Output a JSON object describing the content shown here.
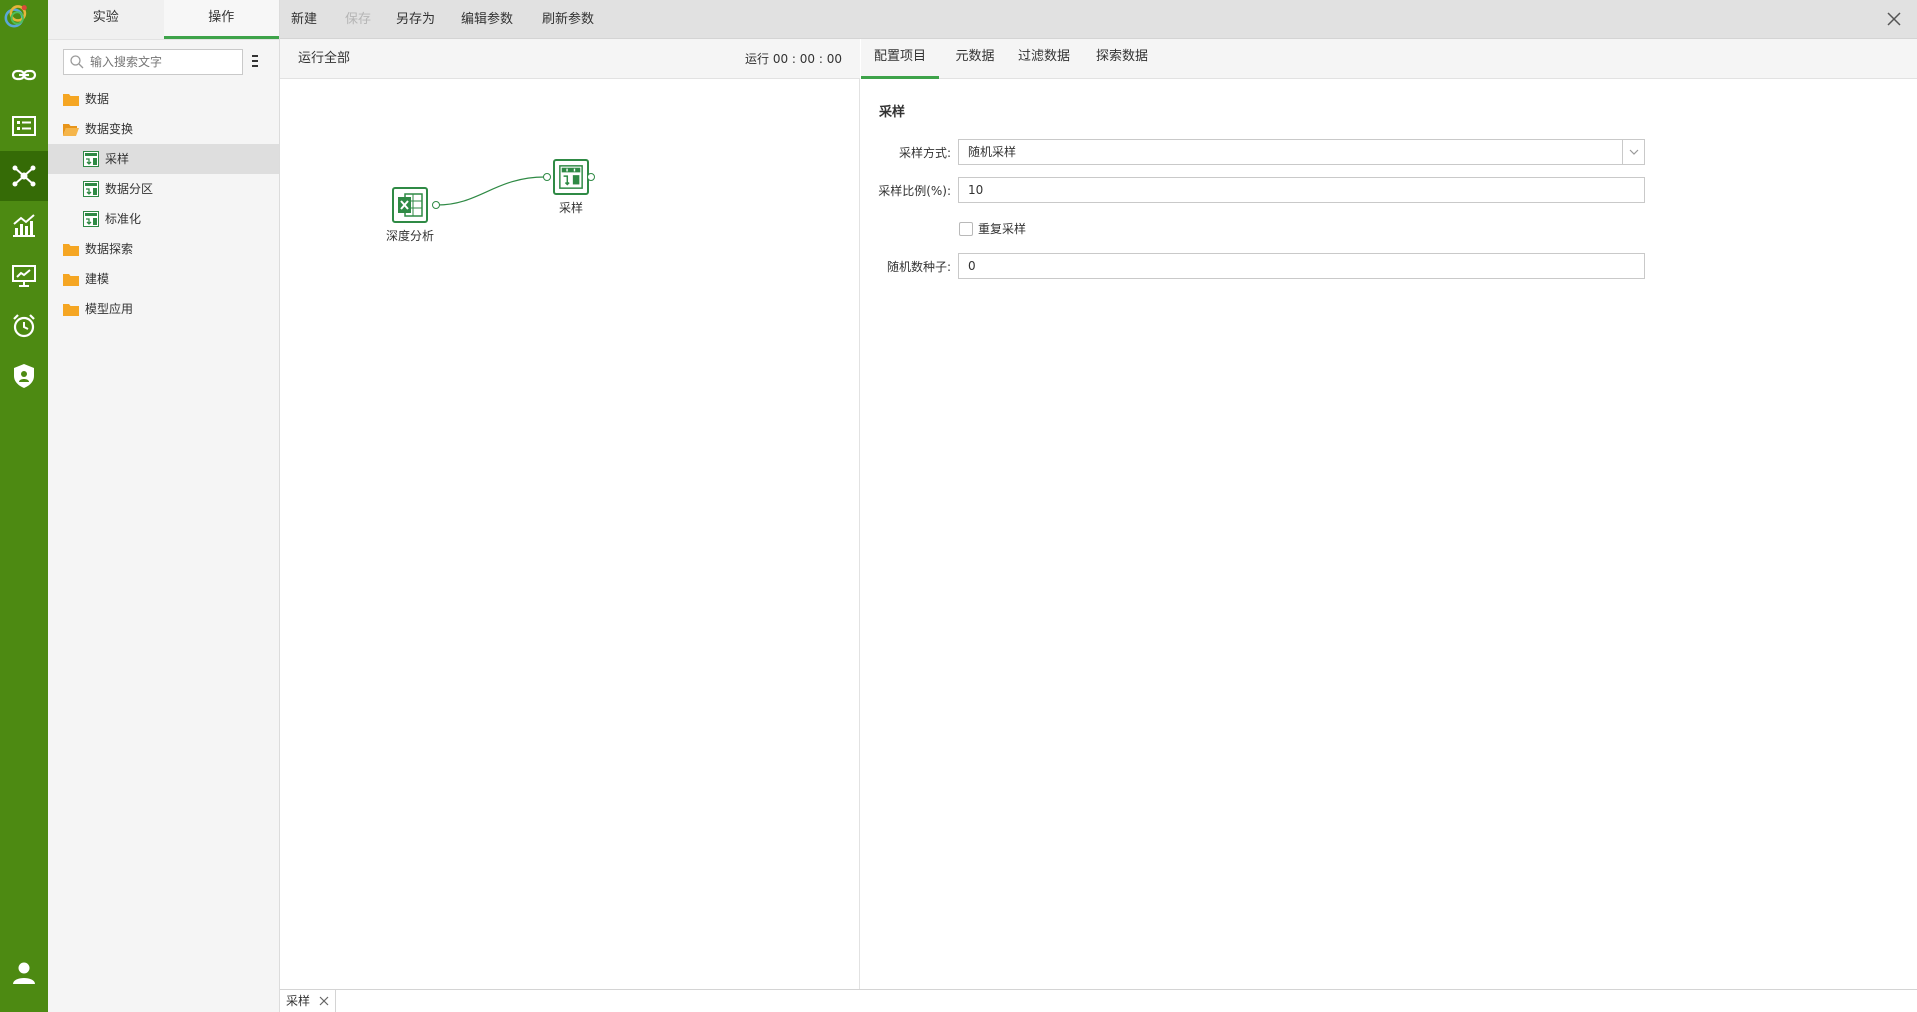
{
  "tree_panel": {
    "tabs": [
      {
        "label": "实验",
        "active": false
      },
      {
        "label": "操作",
        "active": true
      }
    ],
    "search_placeholder": "输入搜索文字",
    "items": [
      {
        "label": "数据",
        "type": "folder"
      },
      {
        "label": "数据变换",
        "type": "folder-open"
      },
      {
        "label": "采样",
        "type": "node",
        "selected": true
      },
      {
        "label": "数据分区",
        "type": "node"
      },
      {
        "label": "标准化",
        "type": "node"
      },
      {
        "label": "数据探索",
        "type": "folder"
      },
      {
        "label": "建模",
        "type": "folder"
      },
      {
        "label": "模型应用",
        "type": "folder"
      }
    ]
  },
  "toolbar": {
    "new_label": "新建",
    "save_label": "保存",
    "save_as_label": "另存为",
    "edit_params_label": "编辑参数",
    "refresh_params_label": "刷新参数"
  },
  "canvas": {
    "run_all_label": "运行全部",
    "run_time": "运行 00 : 00 : 00",
    "nodes": [
      {
        "label": "深度分析",
        "icon": "excel-icon"
      },
      {
        "label": "采样",
        "icon": "sample-icon"
      }
    ]
  },
  "config_panel": {
    "tabs": [
      {
        "label": "配置项目",
        "active": true
      },
      {
        "label": "元数据",
        "active": false
      },
      {
        "label": "过滤数据",
        "active": false
      },
      {
        "label": "探索数据",
        "active": false
      }
    ],
    "section_title": "采样",
    "method_label": "采样方式:",
    "method_value": "随机采样",
    "ratio_label": "采样比例(%):",
    "ratio_value": "10",
    "resample_label": "重复采样",
    "resample_checked": false,
    "seed_label": "随机数种子:",
    "seed_value": "0"
  },
  "bottom_tab": {
    "label": "采样"
  },
  "colors": {
    "rail": "#4d8a12",
    "rail_active": "#356b06",
    "accent": "#3ea34a",
    "node_border": "#2f8a45",
    "folder": "#f5a623"
  }
}
